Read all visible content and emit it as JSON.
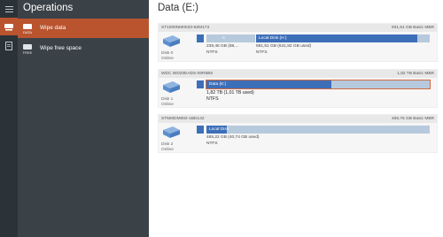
{
  "operations": {
    "title": "Operations",
    "items": [
      {
        "label": "Wipe data",
        "icon_caption": "DATA",
        "icon": "eraser-data-icon",
        "active": true
      },
      {
        "label": "Wipe free space",
        "icon_caption": "FREE",
        "icon": "eraser-free-icon",
        "active": false
      }
    ]
  },
  "rail": {
    "items": [
      {
        "icon": "menu-icon"
      },
      {
        "icon": "eraser-icon",
        "active": true
      },
      {
        "icon": "document-icon"
      }
    ]
  },
  "main": {
    "title": "Data (E:)"
  },
  "disks": [
    {
      "model": "ST1000NM0033-9ZM173",
      "size_type": "931,51 GB Basic MBR",
      "name": "Disk 0",
      "status": "Online",
      "partitions": [
        {
          "name": "",
          "size": "",
          "fs": "",
          "fill": 1.0
        },
        {
          "name": "C",
          "size": "239,46 GB (88,...",
          "fs": "NTFS",
          "fill": 0.0
        },
        {
          "name": "Local Disk (H:)",
          "size": "691,51 GB (641,82 GB used)",
          "fs": "NTFS",
          "fill": 0.93
        }
      ]
    },
    {
      "model": "WDC WD20EADS-00R6B0",
      "size_type": "1,82 TB Basic MBR",
      "name": "Disk 1",
      "status": "Online",
      "partitions": [
        {
          "name": "",
          "size": "",
          "fs": "",
          "fill": 1.0
        },
        {
          "name": "Data (E:)",
          "size": "1,82 TB (1,01 TB used)",
          "fs": "NTFS",
          "fill": 0.56,
          "selected": true
        }
      ]
    },
    {
      "model": "ST500DM002-1BD142",
      "size_type": "465,76 GB Basic MBR",
      "name": "Disk 2",
      "status": "Online",
      "partitions": [
        {
          "name": "",
          "size": "",
          "fs": "",
          "fill": 1.0
        },
        {
          "name": "Local Disk",
          "size": "465,22 GB (40,74 GB used)",
          "fs": "NTFS",
          "fill": 0.09
        }
      ]
    }
  ],
  "colors": {
    "accent": "#b9542f",
    "rail": "#2b3238",
    "panel": "#3a4248",
    "partition_used": "#3d6fb9",
    "partition_free": "#b7c9dc",
    "selection": "#d16b3f"
  }
}
